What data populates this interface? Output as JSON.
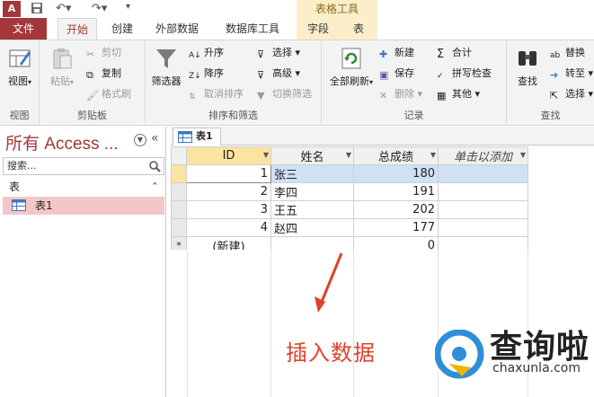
{
  "app": {
    "logo_letter": "A",
    "context_tab_group": "表格工具"
  },
  "ribbon_tabs": [
    "文件",
    "开始",
    "创建",
    "外部数据",
    "数据库工具",
    "字段",
    "表"
  ],
  "ribbon": {
    "groups": {
      "view": {
        "label": "视图",
        "view_button": "视图"
      },
      "clipboard": {
        "label": "剪贴板",
        "paste": "粘贴",
        "cut": "剪切",
        "copy": "复制",
        "format_painter": "格式刷"
      },
      "sort_filter": {
        "label": "排序和筛选",
        "filter": "筛选器",
        "ascending": "升序",
        "descending": "降序",
        "remove_sort": "取消排序",
        "selection": "选择",
        "advanced": "高级",
        "toggle_filter": "切换筛选"
      },
      "records": {
        "label": "记录",
        "refresh_all": "全部刷新",
        "new": "新建",
        "save": "保存",
        "delete": "删除",
        "totals": "合计",
        "spelling": "拼写检查",
        "more": "其他"
      },
      "find": {
        "label": "查找",
        "find": "查找",
        "replace": "替换",
        "goto": "转至",
        "select": "选择"
      }
    }
  },
  "nav_pane": {
    "title": "所有 Access ...",
    "search_placeholder": "搜索...",
    "section": "表",
    "items": [
      "表1"
    ]
  },
  "document": {
    "tab": "表1",
    "columns": [
      "ID",
      "姓名",
      "总成绩",
      "单击以添加"
    ],
    "rows": [
      {
        "id": "1",
        "name": "张三",
        "score": "180"
      },
      {
        "id": "2",
        "name": "李四",
        "score": "191"
      },
      {
        "id": "3",
        "name": "王五",
        "score": "202"
      },
      {
        "id": "4",
        "name": "赵四",
        "score": "177"
      }
    ],
    "new_row": {
      "marker": "*",
      "id": "(新建)",
      "score": "0"
    }
  },
  "annotation": "插入数据",
  "watermark": {
    "brand": "查询啦",
    "url": "chaxunla.com"
  }
}
